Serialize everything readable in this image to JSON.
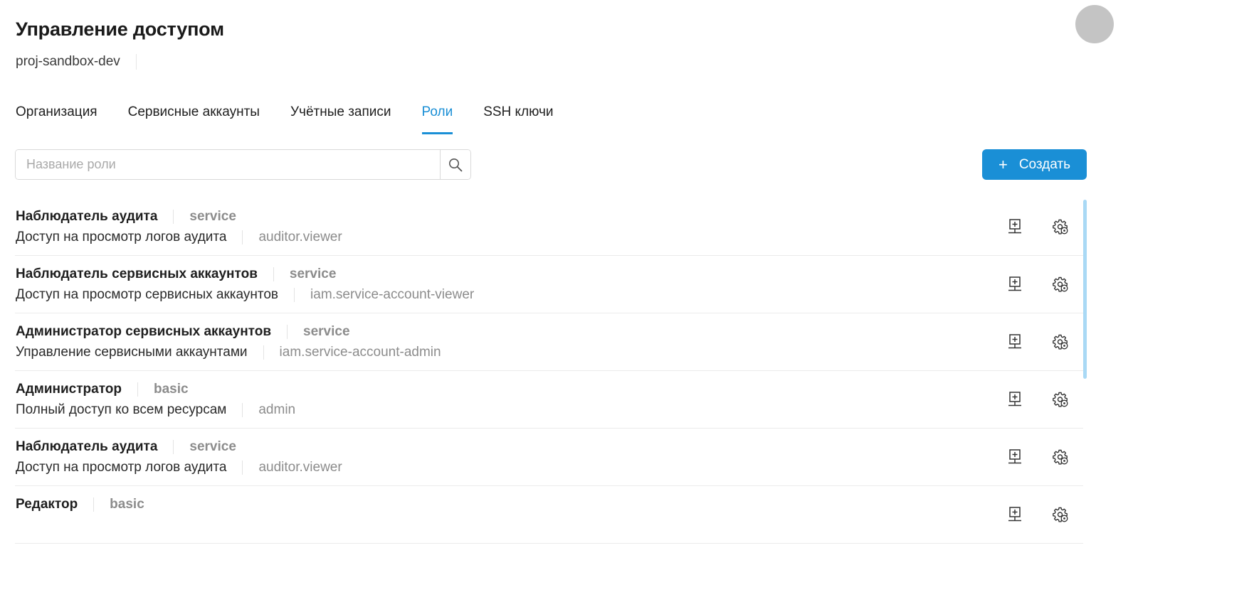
{
  "header": {
    "title": "Управление доступом",
    "project": "proj-sandbox-dev"
  },
  "tabs": [
    {
      "label": "Организация",
      "active": false
    },
    {
      "label": "Сервисные аккаунты",
      "active": false
    },
    {
      "label": "Учётные записи",
      "active": false
    },
    {
      "label": "Роли",
      "active": true
    },
    {
      "label": "SSH ключи",
      "active": false
    }
  ],
  "search": {
    "placeholder": "Название роли",
    "value": ""
  },
  "toolbar": {
    "create_label": "Создать"
  },
  "roles": [
    {
      "name": "Наблюдатель аудита",
      "type": "service",
      "description": "Доступ на просмотр логов аудита",
      "id": "auditor.viewer"
    },
    {
      "name": "Наблюдатель сервисных аккаунтов",
      "type": "service",
      "description": "Доступ на просмотр сервисных аккаунтов",
      "id": "iam.service-account-viewer"
    },
    {
      "name": "Администратор сервисных аккаунтов",
      "type": "service",
      "description": "Управление сервисными аккаунтами",
      "id": "iam.service-account-admin"
    },
    {
      "name": "Администратор",
      "type": "basic",
      "description": "Полный доступ ко всем ресурсам",
      "id": "admin"
    },
    {
      "name": "Наблюдатель аудита",
      "type": "service",
      "description": "Доступ на просмотр логов аудита",
      "id": "auditor.viewer"
    },
    {
      "name": "Редактор",
      "type": "basic",
      "description": "",
      "id": ""
    }
  ],
  "colors": {
    "accent": "#1a8fd6",
    "muted_text": "#8c8c8c",
    "avatar": "#c4c4c4",
    "scrollbar": "#a9d9f5"
  },
  "icons": {
    "search": "search-icon",
    "assign": "assign-role-icon",
    "settings": "gear-settings-icon",
    "create": "plus-icon"
  }
}
